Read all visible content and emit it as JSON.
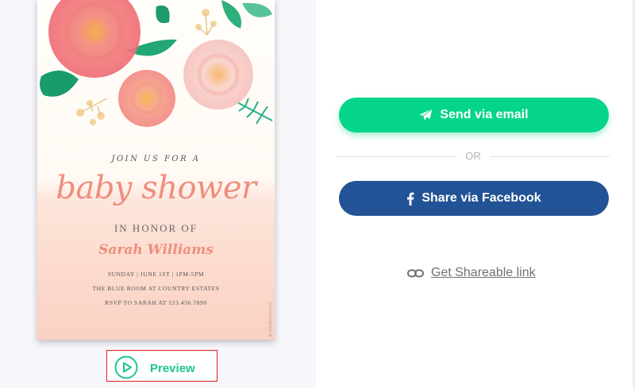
{
  "invitation": {
    "intro": "JOIN US FOR A",
    "title": "baby shower",
    "honor": "IN HONOR OF",
    "name": "Sarah Williams",
    "date_line": "SUNDAY | JUNE 1ST | 1PM-5PM",
    "venue_line": "THE BLUE ROOM AT COUNTRY ESTATES",
    "rsvp_line": "RSVP TO SARAH AT 123.456.7890",
    "credit": "greetingsisland.com"
  },
  "preview": {
    "label": "Preview",
    "icon": "play-circle-icon",
    "color": "#1dc68a",
    "outline_color": "#e02020"
  },
  "share": {
    "email_label": "Send via email",
    "email_icon": "paper-plane-icon",
    "email_color": "#05d58a",
    "or_text": "OR",
    "facebook_label": "Share via Facebook",
    "facebook_icon": "facebook-icon",
    "facebook_color": "#225396",
    "link_label": "Get Shareable link",
    "link_icon": "chain-link-icon"
  }
}
